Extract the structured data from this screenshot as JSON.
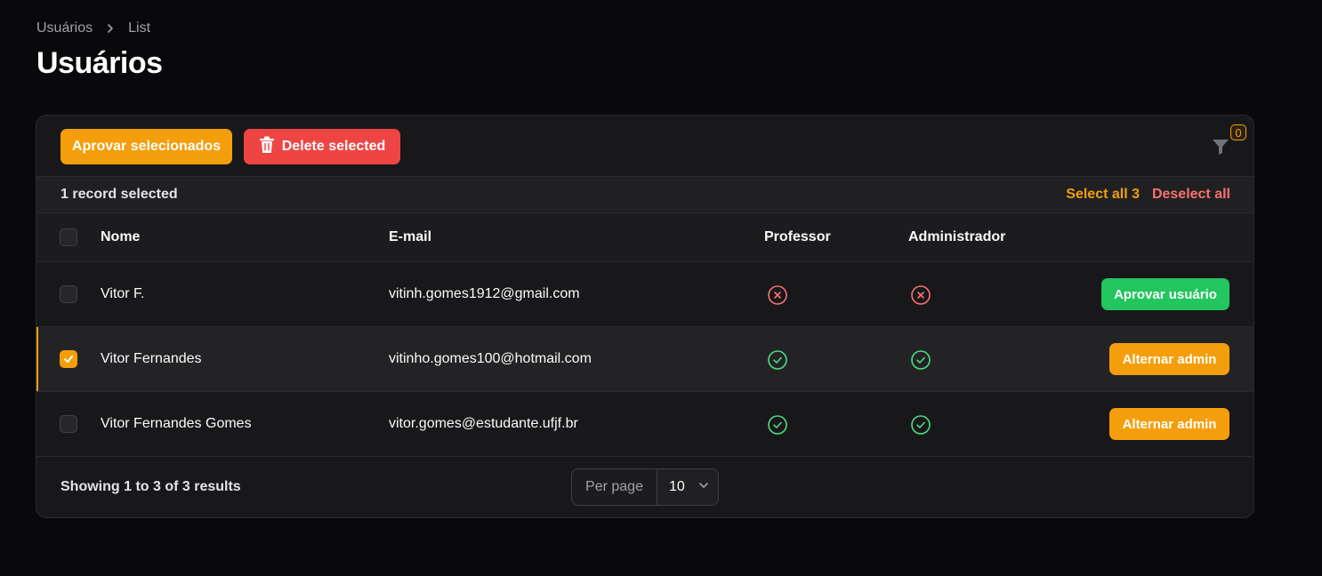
{
  "breadcrumb": {
    "parent": "Usuários",
    "current": "List"
  },
  "page_title": "Usuários",
  "toolbar": {
    "approve_selected_label": "Aprovar selecionados",
    "delete_selected_label": "Delete selected",
    "filter_count": "0",
    "filter_icon": "filter-icon",
    "delete_icon": "trash-icon"
  },
  "selection": {
    "count_text": "1 record selected",
    "select_all_label": "Select all 3",
    "deselect_all_label": "Deselect all"
  },
  "table": {
    "columns": [
      "Nome",
      "E-mail",
      "Professor",
      "Administrador"
    ],
    "rows": [
      {
        "name": "Vitor F.",
        "email": "vitinh.gomes1912@gmail.com",
        "professor": false,
        "admin": false,
        "selected": false,
        "action": "Aprovar usuário"
      },
      {
        "name": "Vitor Fernandes",
        "email": "vitinho.gomes100@hotmail.com",
        "professor": true,
        "admin": true,
        "selected": true,
        "action": "Alternar admin"
      },
      {
        "name": "Vitor Fernandes Gomes",
        "email": "vitor.gomes@estudante.ufjf.br",
        "professor": true,
        "admin": true,
        "selected": false,
        "action": "Alternar admin"
      }
    ]
  },
  "footer": {
    "showing_text": "Showing 1 to 3 of 3 results",
    "per_page_label": "Per page",
    "per_page_value": "10"
  },
  "colors": {
    "accent": "#f59e0b",
    "danger": "#ef4444",
    "success": "#22c55e",
    "background": "#09090b",
    "card": "#18181b"
  }
}
